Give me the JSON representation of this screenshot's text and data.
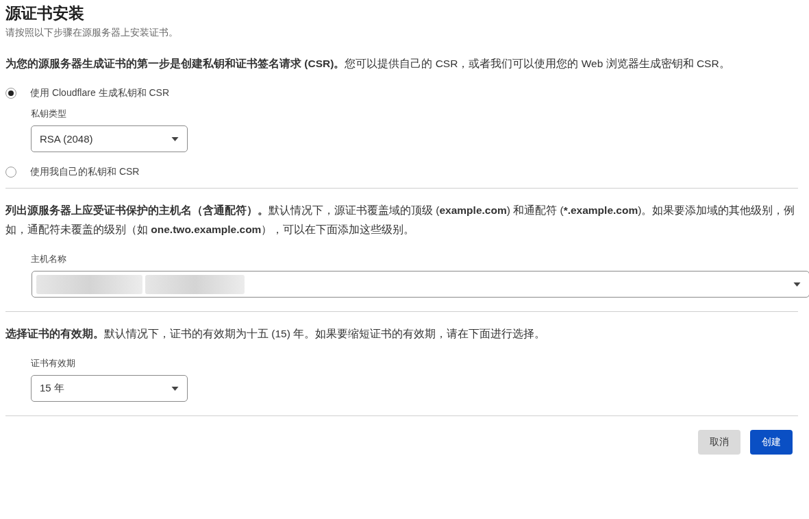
{
  "title": "源证书安装",
  "subtitle": "请按照以下步骤在源服务器上安装证书。",
  "key_section": {
    "description": "**为您的源服务器生成证书的第一步是创建私钥和证书签名请求 (CSR)。**您可以提供自己的 CSR，或者我们可以使用您的 Web 浏览器生成密钥和 CSR。",
    "options": [
      {
        "label": "使用 Cloudflare 生成私钥和 CSR",
        "selected": true,
        "select": {
          "label": "私钥类型",
          "value": "RSA (2048)"
        }
      },
      {
        "label": "使用我自己的私钥和 CSR",
        "selected": false
      }
    ]
  },
  "hostname_section": {
    "description": "**列出源服务器上应受证书保护的主机名（含通配符）。**默认情况下，源证书覆盖域的顶级 (**example.com**) 和通配符 (***.example.com**)。如果要添加域的其他级别，例如，通配符未覆盖的级别（如 **one.two.example.com**），可以在下面添加这些级别。",
    "field_label": "主机名称"
  },
  "validity_section": {
    "description": "**选择证书的有效期。**默认情况下，证书的有效期为十五 (15) 年。如果要缩短证书的有效期，请在下面进行选择。",
    "select": {
      "label": "证书有效期",
      "value": "15 年"
    }
  },
  "buttons": [
    {
      "label": "取消",
      "kind": "secondary"
    },
    {
      "label": "创建",
      "kind": "primary"
    }
  ]
}
